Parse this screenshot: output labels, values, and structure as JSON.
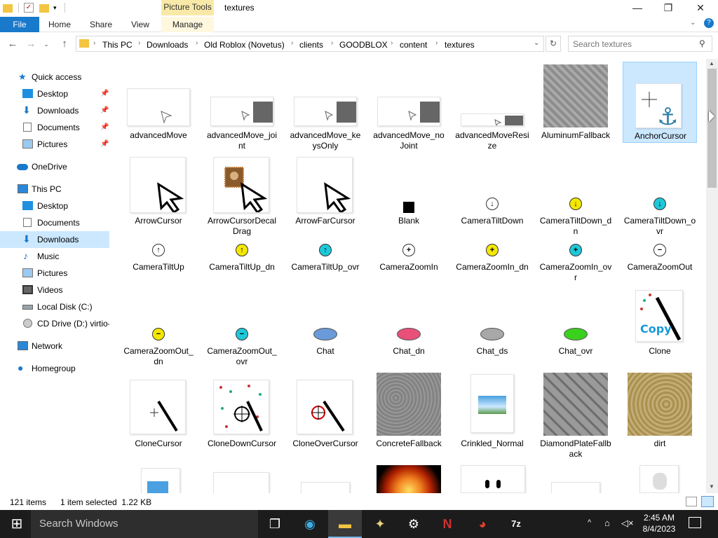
{
  "window": {
    "title": "textures",
    "contextual_tab": "Picture Tools",
    "minimize": "—",
    "maximize": "❐",
    "close": "✕"
  },
  "ribbon": {
    "tabs": [
      "File",
      "Home",
      "Share",
      "View",
      "Manage"
    ]
  },
  "address": {
    "crumbs": [
      "This PC",
      "Downloads",
      "Old Roblox (Novetus)",
      "clients",
      "GOODBLOX",
      "content",
      "textures"
    ],
    "search_placeholder": "Search textures"
  },
  "nav": {
    "quick_access": "Quick access",
    "quick_items": [
      "Desktop",
      "Downloads",
      "Documents",
      "Pictures"
    ],
    "onedrive": "OneDrive",
    "this_pc": "This PC",
    "pc_items": [
      "Desktop",
      "Documents",
      "Downloads",
      "Music",
      "Pictures",
      "Videos",
      "Local Disk (C:)",
      "CD Drive (D:) virtio-"
    ],
    "network": "Network",
    "homegroup": "Homegroup"
  },
  "files": [
    "advancedMove",
    "advancedMove_joint",
    "advancedMove_keysOnly",
    "advancedMove_noJoint",
    "advancedMoveResize",
    "AluminumFallback",
    "AnchorCursor",
    "ArrowCursor",
    "ArrowCursorDecalDrag",
    "ArrowFarCursor",
    "Blank",
    "CameraTiltDown",
    "CameraTiltDown_dn",
    "CameraTiltDown_ovr",
    "CameraTiltUp",
    "CameraTiltUp_dn",
    "CameraTiltUp_ovr",
    "CameraZoomIn",
    "CameraZoomIn_dn",
    "CameraZoomIn_ovr",
    "CameraZoomOut",
    "CameraZoomOut_dn",
    "CameraZoomOut_ovr",
    "Chat",
    "Chat_dn",
    "Chat_ds",
    "Chat_ovr",
    "Clone",
    "CloneCursor",
    "CloneDownCursor",
    "CloneOverCursor",
    "ConcreteFallback",
    "Crinkled_Normal",
    "DiamondPlateFallback",
    "dirt"
  ],
  "clone_thumb_text": "Copy",
  "status": {
    "items": "121 items",
    "selection": "1 item selected  1.22 KB"
  },
  "taskbar": {
    "search_placeholder": "Search Windows",
    "time": "2:45 AM",
    "date": "8/4/2023"
  },
  "colors": {
    "file_tab": "#1979ca",
    "selection": "#cce8ff",
    "contextual": "#f8e9a8",
    "taskbar": "#1c1c1c"
  }
}
